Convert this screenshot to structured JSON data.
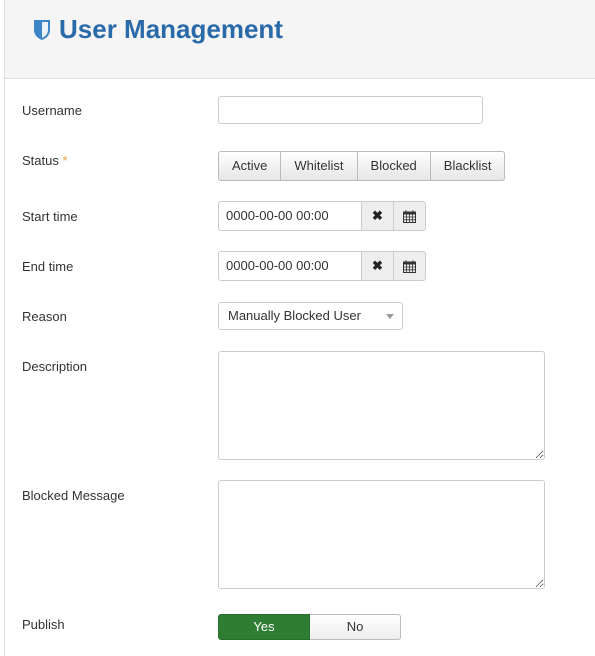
{
  "header": {
    "title": "User Management",
    "icon": "shield-icon",
    "accent_color": "#2a6aa8"
  },
  "form": {
    "username": {
      "label": "Username",
      "value": "",
      "placeholder": ""
    },
    "status": {
      "label": "Status",
      "required_marker": "*",
      "options": [
        "Active",
        "Whitelist",
        "Blocked",
        "Blacklist"
      ]
    },
    "start_time": {
      "label": "Start time",
      "value": "0000-00-00 00:00",
      "clear_icon": "close-icon",
      "calendar_icon": "calendar-icon"
    },
    "end_time": {
      "label": "End time",
      "value": "0000-00-00 00:00",
      "clear_icon": "close-icon",
      "calendar_icon": "calendar-icon"
    },
    "reason": {
      "label": "Reason",
      "selected": "Manually Blocked User"
    },
    "description": {
      "label": "Description",
      "value": ""
    },
    "blocked_message": {
      "label": "Blocked Message",
      "value": ""
    },
    "publish": {
      "label": "Publish",
      "yes_label": "Yes",
      "no_label": "No",
      "selected": "Yes",
      "active_color": "#2f7d32"
    }
  }
}
